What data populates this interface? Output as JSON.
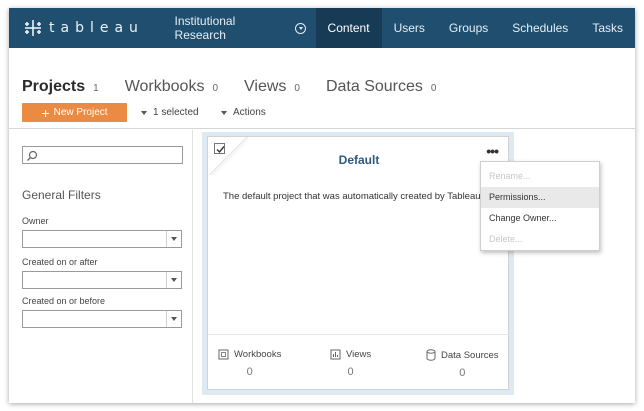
{
  "brand": {
    "logo_text": "tableau"
  },
  "topnav": {
    "site_name": "Institutional Research",
    "tabs": [
      {
        "label": "Content",
        "active": true
      },
      {
        "label": "Users",
        "active": false
      },
      {
        "label": "Groups",
        "active": false
      },
      {
        "label": "Schedules",
        "active": false
      },
      {
        "label": "Tasks",
        "active": false
      }
    ]
  },
  "subtabs": [
    {
      "label": "Projects",
      "count": "1",
      "active": true
    },
    {
      "label": "Workbooks",
      "count": "0",
      "active": false
    },
    {
      "label": "Views",
      "count": "0",
      "active": false
    },
    {
      "label": "Data Sources",
      "count": "0",
      "active": false
    }
  ],
  "actionbar": {
    "new_project_label": "New Project",
    "selected_label": "1 selected",
    "actions_label": "Actions"
  },
  "filters": {
    "search_value": "",
    "title": "General Filters",
    "owner_label": "Owner",
    "owner_value": "",
    "created_after_label": "Created on or after",
    "created_after_value": "",
    "created_before_label": "Created on or before",
    "created_before_value": ""
  },
  "project_card": {
    "title": "Default",
    "checked": true,
    "description": "The default project that was automatically created by Tableau.",
    "stats": [
      {
        "label": "Workbooks",
        "value": "0",
        "icon": "workbook-icon"
      },
      {
        "label": "Views",
        "value": "0",
        "icon": "view-icon"
      },
      {
        "label": "Data Sources",
        "value": "0",
        "icon": "datasource-icon"
      }
    ]
  },
  "context_menu": {
    "items": [
      {
        "label": "Rename...",
        "enabled": false
      },
      {
        "label": "Permissions...",
        "enabled": true,
        "hover": true
      },
      {
        "label": "Change Owner...",
        "enabled": true
      },
      {
        "label": "Delete...",
        "enabled": false
      }
    ]
  },
  "colors": {
    "nav_bg": "#1f4e6f",
    "nav_active": "#173b55",
    "accent_orange": "#eb8b43",
    "title_blue": "#2c5a80"
  }
}
